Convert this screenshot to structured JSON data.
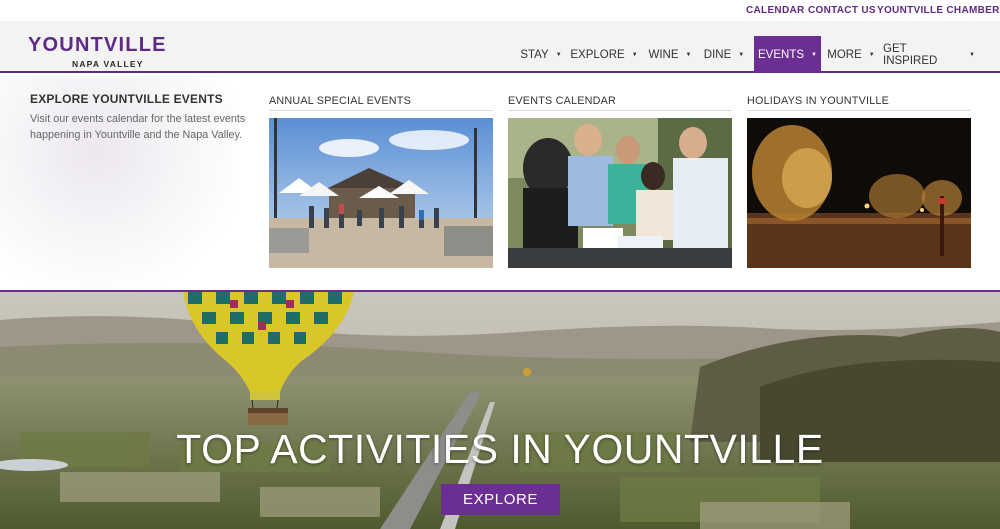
{
  "utility_nav": {
    "calendar": "CALENDAR",
    "contact": "CONTACT US",
    "chamber": "YOUNTVILLE CHAMBER"
  },
  "logo": {
    "main": "YOUNTVILLE",
    "sub": "NAPA VALLEY"
  },
  "main_nav": {
    "items": [
      {
        "label": "STAY",
        "icon": "caret-down-icon"
      },
      {
        "label": "EXPLORE",
        "icon": "caret-down-icon"
      },
      {
        "label": "WINE",
        "icon": "caret-down-icon"
      },
      {
        "label": "DINE",
        "icon": "caret-down-icon"
      },
      {
        "label": "EVENTS",
        "icon": "caret-down-icon",
        "active": true
      },
      {
        "label": "MORE",
        "icon": "caret-down-icon"
      },
      {
        "label": "GET INSPIRED",
        "icon": "caret-down-icon"
      }
    ],
    "caret": "▼"
  },
  "mega_menu": {
    "intro_title": "EXPLORE YOUNTVILLE EVENTS",
    "intro_text": "Visit our events calendar for the latest events happening in Yountville and the Napa Valley.",
    "columns": [
      {
        "title": "ANNUAL SPECIAL EVENTS"
      },
      {
        "title": "EVENTS CALENDAR"
      },
      {
        "title": "HOLIDAYS IN YOUNTVILLE"
      }
    ]
  },
  "hero": {
    "title": "TOP ACTIVITIES IN YOUNTVILLE",
    "button": "EXPLORE"
  },
  "colors": {
    "brand_purple": "#5e2a84",
    "active_nav": "#6b2e93",
    "header_bg": "#f4f3f3"
  }
}
